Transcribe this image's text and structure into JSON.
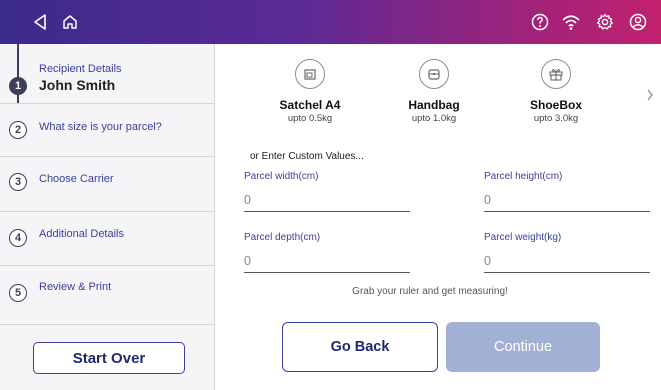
{
  "header": {
    "icons": [
      "back-icon",
      "home-icon",
      "help-icon",
      "wifi-icon",
      "settings-icon",
      "account-icon"
    ]
  },
  "sidebar": {
    "steps": [
      {
        "number": "1",
        "label": "Recipient Details",
        "value": "John Smith"
      },
      {
        "number": "2",
        "label": "What size is your parcel?"
      },
      {
        "number": "3",
        "label": "Choose Carrier"
      },
      {
        "number": "4",
        "label": "Additional Details"
      },
      {
        "number": "5",
        "label": "Review & Print"
      }
    ],
    "start_over_label": "Start Over"
  },
  "packages": [
    {
      "name": "Satchel A4",
      "weight": "upto 0.5kg",
      "icon": "satchel-icon"
    },
    {
      "name": "Handbag",
      "weight": "upto 1.0kg",
      "icon": "handbag-icon"
    },
    {
      "name": "ShoeBox",
      "weight": "upto 3.0kg",
      "icon": "gift-box-icon"
    }
  ],
  "custom": {
    "title": "or Enter Custom Values...",
    "fields": {
      "width": {
        "label": "Parcel width(cm)",
        "value": "0"
      },
      "height": {
        "label": "Parcel height(cm)",
        "value": "0"
      },
      "depth": {
        "label": "Parcel depth(cm)",
        "value": "0"
      },
      "weight": {
        "label": "Parcel weight(kg)",
        "value": "0"
      }
    },
    "hint": "Grab your ruler and get measuring!"
  },
  "actions": {
    "go_back_label": "Go Back",
    "continue_label": "Continue"
  },
  "colors": {
    "header_start": "#3b2a8c",
    "header_end": "#c2216e",
    "accent": "#3b3f9e",
    "continue_disabled": "#a3b0d6"
  }
}
